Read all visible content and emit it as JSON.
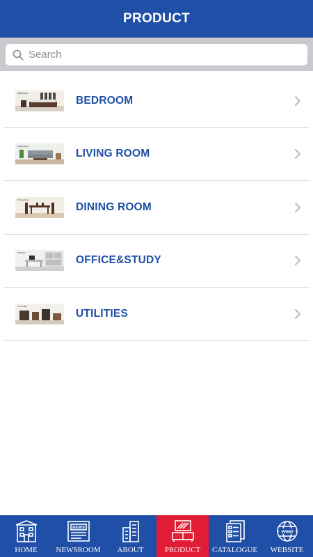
{
  "header": {
    "title": "PRODUCT"
  },
  "search": {
    "placeholder": "Search"
  },
  "categories": [
    {
      "label": "BEDROOM",
      "thumb_label": "BEDROOM"
    },
    {
      "label": "LIVING ROOM",
      "thumb_label": "Living Room"
    },
    {
      "label": "DINING ROOM",
      "thumb_label": "Dining Room"
    },
    {
      "label": "OFFICE&STUDY",
      "thumb_label": "OFFICE"
    },
    {
      "label": "UTILITIES",
      "thumb_label": "UTILITIES"
    }
  ],
  "tabs": [
    {
      "label": "HOME",
      "icon": "home-building-icon",
      "active": false
    },
    {
      "label": "NEWSROOM",
      "icon": "news-icon",
      "active": false
    },
    {
      "label": "ABOUT",
      "icon": "buildings-icon",
      "active": false
    },
    {
      "label": "PRODUCT",
      "icon": "tv-furniture-icon",
      "active": true
    },
    {
      "label": "CATALOGUE",
      "icon": "catalogue-icon",
      "active": false
    },
    {
      "label": "WEBSITE",
      "icon": "globe-www-icon",
      "active": false
    }
  ],
  "colors": {
    "brand_blue": "#1f4fa6",
    "active_red": "#e11d36",
    "search_bg": "#c9c9ce"
  }
}
